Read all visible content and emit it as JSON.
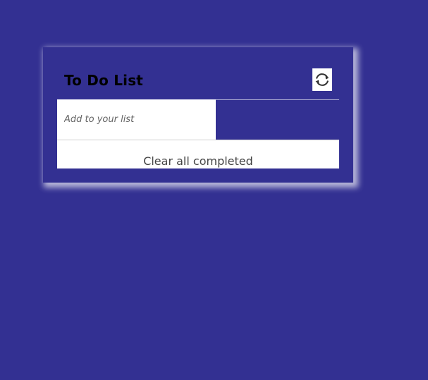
{
  "app": {
    "title": "To Do List"
  },
  "input": {
    "value": "",
    "placeholder": "Add to your list"
  },
  "actions": {
    "refresh_icon": "refresh-icon",
    "clear_label": "Clear all completed"
  },
  "colors": {
    "background": "#333092",
    "card": "#333092",
    "surface": "#ffffff"
  }
}
